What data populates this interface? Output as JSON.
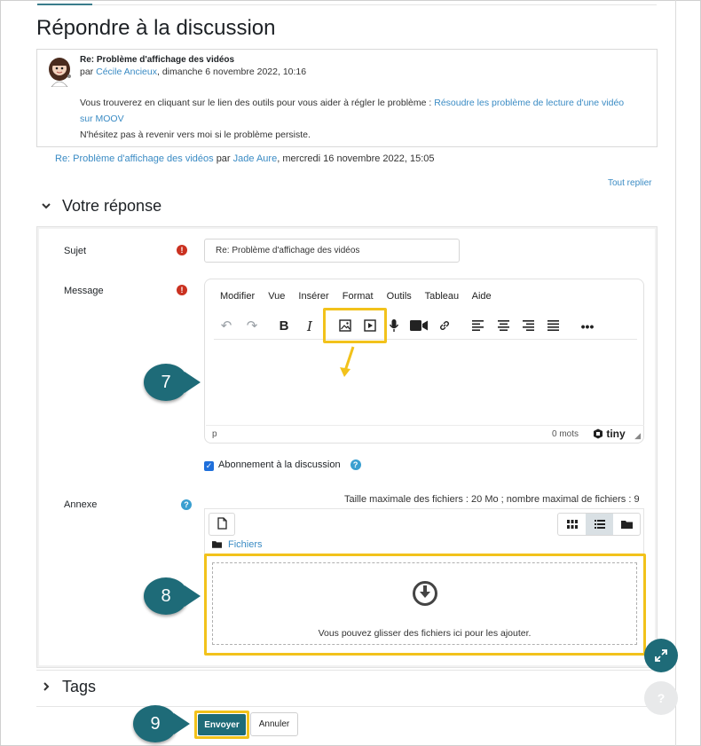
{
  "page": {
    "title": "Répondre à la discussion"
  },
  "post": {
    "subject": "Re: Problème d'affichage des vidéos",
    "meta_prefix": "par",
    "author": "Cécile Ancieux",
    "date": ", dimanche 6 novembre 2022, 10:16",
    "body_text": "Vous trouverez en cliquant sur le lien des outils pour vous aider à régler le problème :",
    "body_link": "Résoudre les problème de lecture d'une vidéo sur MOOV",
    "body_text2": "N'hésitez pas à revenir vers moi si le problème persiste."
  },
  "reply_line": {
    "link": "Re: Problème d'affichage des vidéos",
    "by": "par",
    "author": "Jade Aure",
    "date": ", mercredi 16 novembre 2022, 15:05"
  },
  "tout_replier": "Tout replier",
  "sections": {
    "votre_reponse": "Votre réponse",
    "tags": "Tags"
  },
  "form": {
    "subject_label": "Sujet",
    "subject_value": "Re: Problème d'affichage des vidéos",
    "message_label": "Message",
    "annexe_label": "Annexe",
    "subscribe_label": "Abonnement à la discussion",
    "file_limits": "Taille maximale des fichiers : 20 Mo ; nombre maximal de fichiers : 9",
    "files_crumb": "Fichiers",
    "drop_text": "Vous pouvez glisser des fichiers ici pour les ajouter."
  },
  "editor": {
    "menus": [
      "Modifier",
      "Vue",
      "Insérer",
      "Format",
      "Outils",
      "Tableau",
      "Aide"
    ],
    "status_path": "p",
    "word_count": "0 mots",
    "brand": "tiny",
    "toolbar_icons": [
      "undo-icon",
      "redo-icon",
      "bold-icon",
      "italic-icon",
      "image-icon",
      "media-icon",
      "microphone-icon",
      "camera-icon",
      "link-icon",
      "align-left-icon",
      "align-center-icon",
      "align-right-icon",
      "justify-icon",
      "more-icon"
    ]
  },
  "callouts": {
    "c7": "7",
    "c8": "8",
    "c9": "9"
  },
  "buttons": {
    "send": "Envoyer",
    "cancel": "Annuler"
  },
  "colors": {
    "link": "#3a8bc4",
    "primary": "#1e6b78",
    "highlight": "#f2c21b",
    "required": "#ca3120",
    "help": "#3a9fd0"
  }
}
